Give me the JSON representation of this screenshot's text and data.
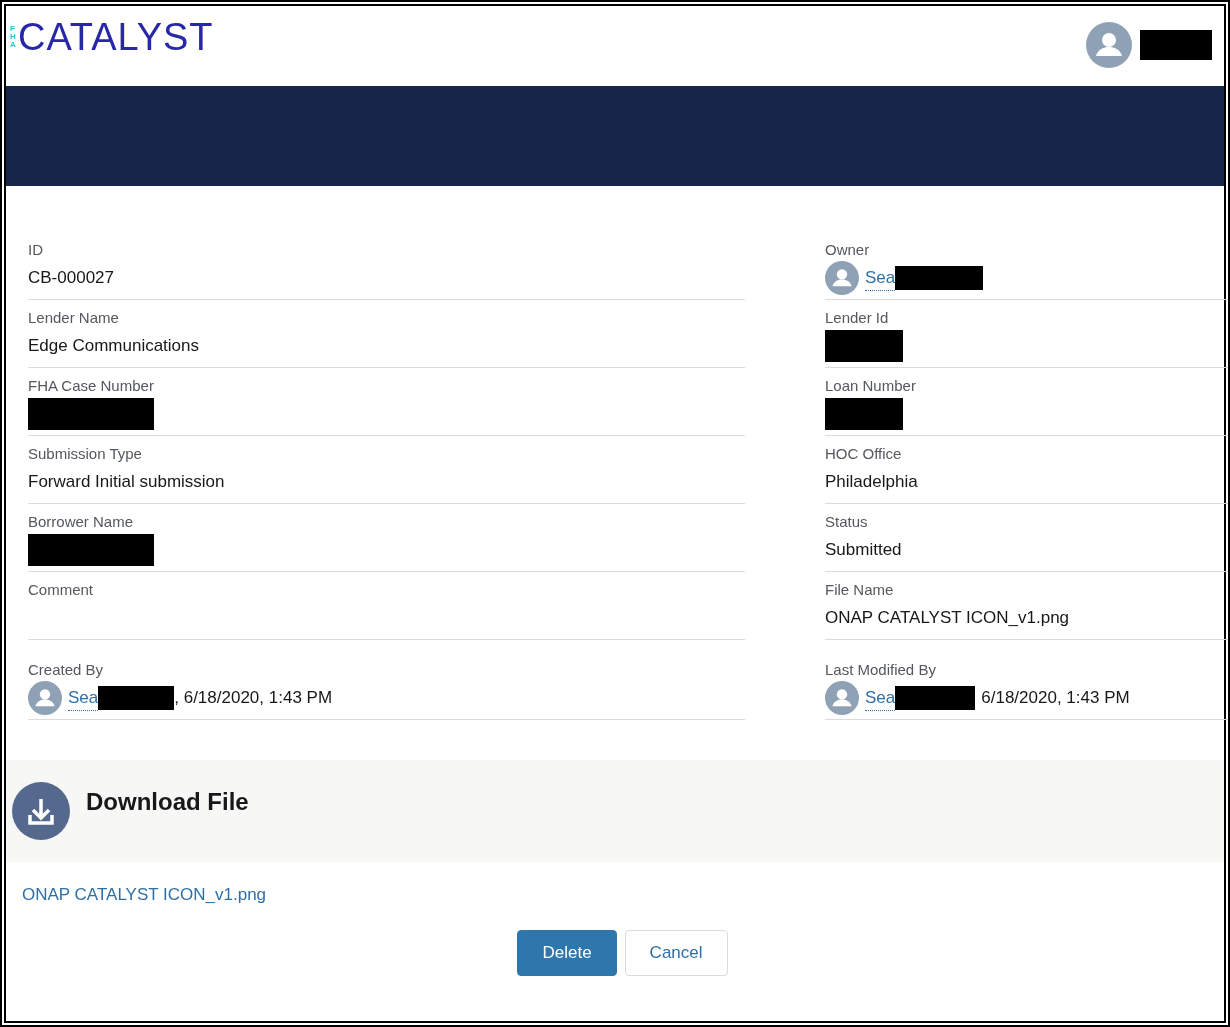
{
  "header": {
    "logo_small": "FHA",
    "logo": "CATALYST",
    "user_redacted": true
  },
  "left_fields": [
    {
      "kind": "text",
      "label": "ID",
      "value": "CB-000027"
    },
    {
      "kind": "text",
      "label": "Lender Name",
      "value": "Edge Communications"
    },
    {
      "kind": "text",
      "label": "FHA Case Number",
      "redacted": true
    },
    {
      "kind": "text",
      "label": "Submission Type",
      "value": "Forward Initial submission"
    },
    {
      "kind": "text",
      "label": "Borrower Name",
      "redacted": true
    },
    {
      "kind": "text",
      "label": "Comment"
    },
    {
      "kind": "user",
      "label": "Created By",
      "link": "Sea",
      "redacted": true,
      "suffix": ", 6/18/2020, 1:43 PM"
    }
  ],
  "right_fields": [
    {
      "kind": "user",
      "label": "Owner",
      "link": "Sea",
      "redacted": true
    },
    {
      "kind": "text",
      "label": "Lender Id",
      "redacted": true
    },
    {
      "kind": "text",
      "label": "Loan Number",
      "redacted": true
    },
    {
      "kind": "text",
      "label": "HOC Office",
      "value": "Philadelphia"
    },
    {
      "kind": "text",
      "label": "Status",
      "value": "Submitted"
    },
    {
      "kind": "text",
      "label": "File Name",
      "value": "ONAP CATALYST ICON_v1.png"
    },
    {
      "kind": "user",
      "label": "Last Modified By",
      "link": "Sea",
      "redacted": true,
      "suffix": "6/18/2020, 1:43 PM"
    }
  ],
  "download": {
    "title": "Download File",
    "file_link": "ONAP CATALYST ICON_v1.png"
  },
  "buttons": [
    {
      "label": "Delete",
      "kind": "primary"
    },
    {
      "label": "Cancel",
      "kind": "neutral"
    }
  ]
}
